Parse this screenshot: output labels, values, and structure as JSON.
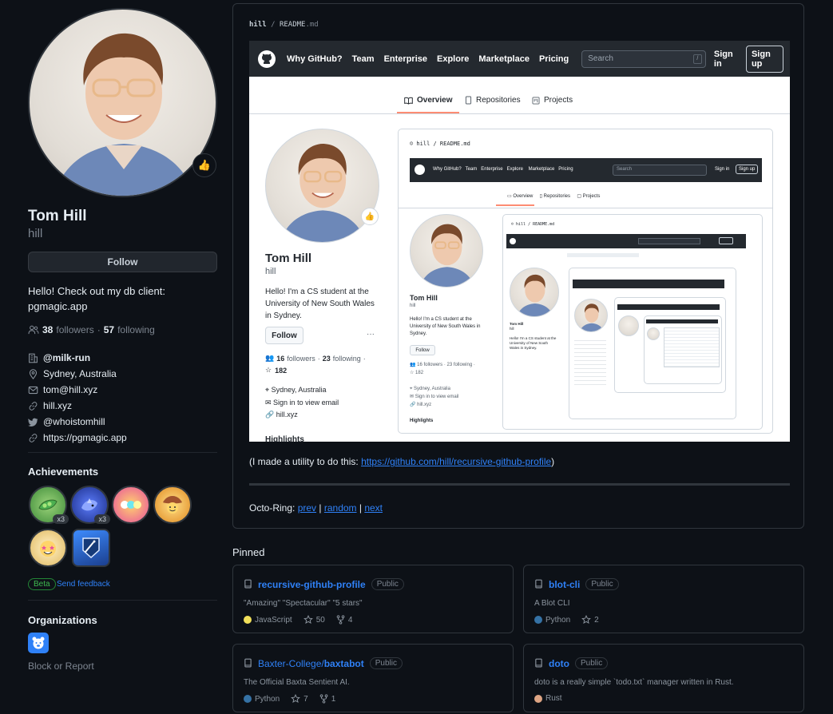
{
  "profile": {
    "fullname": "Tom Hill",
    "username": "hill",
    "status_emoji": "👍",
    "follow_label": "Follow",
    "bio_line1": "Hello! Check out my db client:",
    "bio_line2": "pgmagic.app",
    "followers_count": "38",
    "followers_label": "followers",
    "following_count": "57",
    "following_label": "following",
    "company": "@milk-run",
    "location": "Sydney, Australia",
    "email": "tom@hill.xyz",
    "website": "hill.xyz",
    "twitter": "@whoistomhill",
    "extra_link": "https://pgmagic.app"
  },
  "achievements": {
    "title": "Achievements",
    "badges": [
      {
        "name": "pair-extraordinaire",
        "count": "x3",
        "color": "#4fa34a"
      },
      {
        "name": "pull-shark",
        "count": "x3",
        "color": "#3b5bdb"
      },
      {
        "name": "yolo",
        "count": "",
        "color": "#e8509d"
      },
      {
        "name": "quickdraw",
        "count": "",
        "color": "#f0a020"
      },
      {
        "name": "starstruck",
        "count": "",
        "color": "#d4a84a"
      },
      {
        "name": "arctic-code-vault",
        "count": "",
        "color": "#2f6fd6"
      }
    ],
    "beta_label": "Beta",
    "feedback_label": "Send feedback"
  },
  "organizations": {
    "title": "Organizations",
    "block_report": "Block or Report"
  },
  "readme": {
    "owner": "hill",
    "separator": "/",
    "file": "README",
    "ext": ".md",
    "caption_prefix": "(I made a utility to do this: ",
    "caption_link": "https://github.com/hill/recursive-github-profile",
    "caption_suffix": ")",
    "octo_label": "Octo-Ring:",
    "octo_prev": "prev",
    "octo_random": "random",
    "octo_next": "next"
  },
  "embedded": {
    "nav": [
      "Why GitHub?",
      "Team",
      "Enterprise",
      "Explore",
      "Marketplace",
      "Pricing"
    ],
    "search_placeholder": "Search",
    "slash": "/",
    "sign_in": "Sign in",
    "sign_up": "Sign up",
    "tabs": [
      "Overview",
      "Repositories",
      "Projects"
    ],
    "fullname": "Tom Hill",
    "username": "hill",
    "bio": "Hello! I'm a CS student at the University of New South Wales in Sydney.",
    "follow_label": "Follow",
    "more": "···",
    "followers": "16",
    "followers_label": "followers",
    "following": "23",
    "following_label": "following",
    "stars": "182",
    "location": "Sydney, Australia",
    "email": "Sign in to view email",
    "website": "hill.xyz",
    "highlights": "Highlights"
  },
  "pinned": {
    "title": "Pinned",
    "repos": [
      {
        "owner": "",
        "name": "recursive-github-profile",
        "visibility": "Public",
        "desc": "\"Amazing\" \"Spectacular\" \"5 stars\"",
        "lang": "JavaScript",
        "lang_color": "#f1e05a",
        "stars": "50",
        "forks": "4"
      },
      {
        "owner": "",
        "name": "blot-cli",
        "visibility": "Public",
        "desc": "A Blot CLI",
        "lang": "Python",
        "lang_color": "#3572A5",
        "stars": "2",
        "forks": ""
      },
      {
        "owner": "Baxter-College/",
        "name": "baxtabot",
        "visibility": "Public",
        "desc": "The Official Baxta Sentient AI.",
        "lang": "Python",
        "lang_color": "#3572A5",
        "stars": "7",
        "forks": "1"
      },
      {
        "owner": "",
        "name": "doto",
        "visibility": "Public",
        "desc": "doto is a really simple `todo.txt` manager written in Rust.",
        "lang": "Rust",
        "lang_color": "#dea584",
        "stars": "",
        "forks": ""
      }
    ]
  }
}
